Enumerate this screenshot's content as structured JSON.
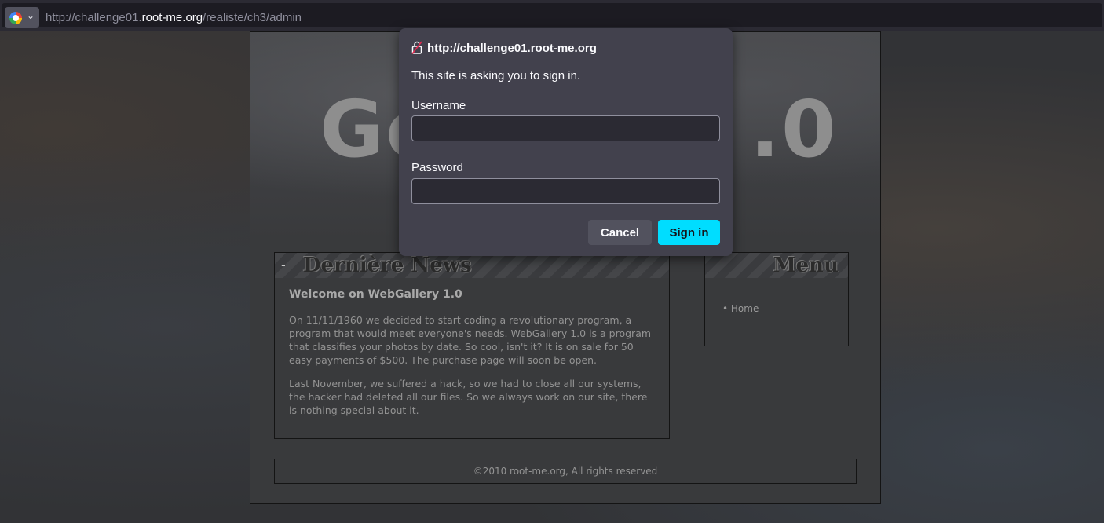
{
  "browser": {
    "url_prefix": "http://challenge01.",
    "url_host": "root-me.org",
    "url_path": "/realiste/ch3/admin",
    "site_icon": "google-g-icon",
    "menu_icon": "chevron-down-icon"
  },
  "page": {
    "header_title_left": "Go",
    "header_title_right": ".0",
    "news": {
      "box_title": "Dernière News",
      "heading": "Welcome on WebGallery 1.0",
      "paragraph1": "On 11/11/1960 we decided to start coding a revolutionary program, a program that would meet everyone's needs. WebGallery 1.0 is a program that classifies your photos by date. So cool, isn't it? It is on sale for 50 easy payments of $500. The purchase page will soon be open.",
      "paragraph2": "Last November, we suffered a hack, so we had to close all our systems, the hacker had deleted all our files. So we always work on our site, there is nothing special about it."
    },
    "menu": {
      "title": "Menu",
      "items": [
        "Home"
      ]
    },
    "footer": "©2010 root-me.org, All rights reserved"
  },
  "dialog": {
    "origin": "http://challenge01.root-me.org",
    "message": "This site is asking you to sign in.",
    "username_label": "Username",
    "username_value": "",
    "password_label": "Password",
    "password_value": "",
    "cancel_label": "Cancel",
    "signin_label": "Sign in",
    "lock_icon": "insecure-lock-icon",
    "accent_color": "#00ddff"
  }
}
